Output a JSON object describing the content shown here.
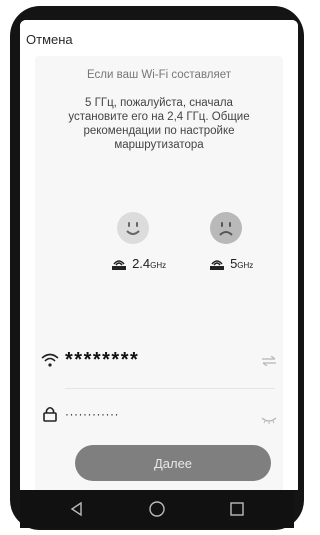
{
  "topbar": {
    "cancel_label": "Отмена"
  },
  "info": {
    "partial_line": "Если ваш Wi-Fi составляет",
    "text": "5 ГГц, пожалуйста, сначала\nустановите его на 2,4 ГГц. Общие\nрекомендации по настройке\nмаршрутизатора"
  },
  "bands": [
    {
      "face": "happy-face-icon",
      "value": "2.4",
      "unit": "GHz",
      "face_color": "#dcdcdc"
    },
    {
      "face": "sad-face-icon",
      "value": "5",
      "unit": "GHz",
      "face_color": "#b9b9b9"
    }
  ],
  "wifi_row": {
    "ssid_value": "********",
    "icon": "wifi-icon",
    "action_icon": "swap-icon"
  },
  "password_row": {
    "password_value": "············",
    "icon": "lock-icon",
    "action_icon": "eye-hidden-icon"
  },
  "next_button": {
    "label": "Далее"
  },
  "navbar": {
    "back": "back-icon",
    "home": "home-icon",
    "recent": "recent-apps-icon"
  }
}
